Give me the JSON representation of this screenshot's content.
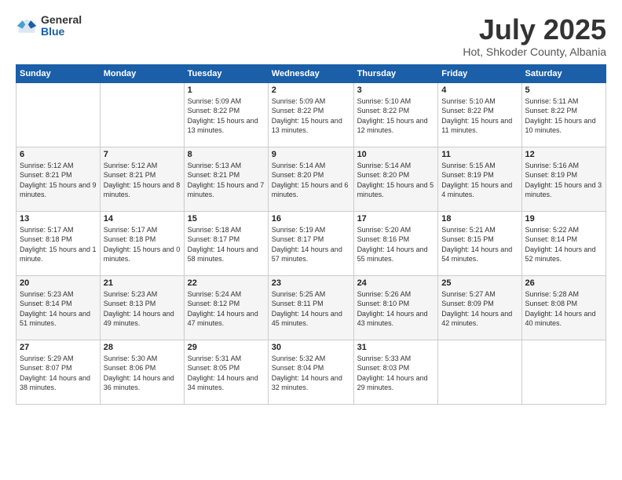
{
  "logo": {
    "general": "General",
    "blue": "Blue"
  },
  "header": {
    "month": "July 2025",
    "location": "Hot, Shkoder County, Albania"
  },
  "weekdays": [
    "Sunday",
    "Monday",
    "Tuesday",
    "Wednesday",
    "Thursday",
    "Friday",
    "Saturday"
  ],
  "weeks": [
    [
      {
        "day": "",
        "sunrise": "",
        "sunset": "",
        "daylight": ""
      },
      {
        "day": "",
        "sunrise": "",
        "sunset": "",
        "daylight": ""
      },
      {
        "day": "1",
        "sunrise": "Sunrise: 5:09 AM",
        "sunset": "Sunset: 8:22 PM",
        "daylight": "Daylight: 15 hours and 13 minutes."
      },
      {
        "day": "2",
        "sunrise": "Sunrise: 5:09 AM",
        "sunset": "Sunset: 8:22 PM",
        "daylight": "Daylight: 15 hours and 13 minutes."
      },
      {
        "day": "3",
        "sunrise": "Sunrise: 5:10 AM",
        "sunset": "Sunset: 8:22 PM",
        "daylight": "Daylight: 15 hours and 12 minutes."
      },
      {
        "day": "4",
        "sunrise": "Sunrise: 5:10 AM",
        "sunset": "Sunset: 8:22 PM",
        "daylight": "Daylight: 15 hours and 11 minutes."
      },
      {
        "day": "5",
        "sunrise": "Sunrise: 5:11 AM",
        "sunset": "Sunset: 8:22 PM",
        "daylight": "Daylight: 15 hours and 10 minutes."
      }
    ],
    [
      {
        "day": "6",
        "sunrise": "Sunrise: 5:12 AM",
        "sunset": "Sunset: 8:21 PM",
        "daylight": "Daylight: 15 hours and 9 minutes."
      },
      {
        "day": "7",
        "sunrise": "Sunrise: 5:12 AM",
        "sunset": "Sunset: 8:21 PM",
        "daylight": "Daylight: 15 hours and 8 minutes."
      },
      {
        "day": "8",
        "sunrise": "Sunrise: 5:13 AM",
        "sunset": "Sunset: 8:21 PM",
        "daylight": "Daylight: 15 hours and 7 minutes."
      },
      {
        "day": "9",
        "sunrise": "Sunrise: 5:14 AM",
        "sunset": "Sunset: 8:20 PM",
        "daylight": "Daylight: 15 hours and 6 minutes."
      },
      {
        "day": "10",
        "sunrise": "Sunrise: 5:14 AM",
        "sunset": "Sunset: 8:20 PM",
        "daylight": "Daylight: 15 hours and 5 minutes."
      },
      {
        "day": "11",
        "sunrise": "Sunrise: 5:15 AM",
        "sunset": "Sunset: 8:19 PM",
        "daylight": "Daylight: 15 hours and 4 minutes."
      },
      {
        "day": "12",
        "sunrise": "Sunrise: 5:16 AM",
        "sunset": "Sunset: 8:19 PM",
        "daylight": "Daylight: 15 hours and 3 minutes."
      }
    ],
    [
      {
        "day": "13",
        "sunrise": "Sunrise: 5:17 AM",
        "sunset": "Sunset: 8:18 PM",
        "daylight": "Daylight: 15 hours and 1 minute."
      },
      {
        "day": "14",
        "sunrise": "Sunrise: 5:17 AM",
        "sunset": "Sunset: 8:18 PM",
        "daylight": "Daylight: 15 hours and 0 minutes."
      },
      {
        "day": "15",
        "sunrise": "Sunrise: 5:18 AM",
        "sunset": "Sunset: 8:17 PM",
        "daylight": "Daylight: 14 hours and 58 minutes."
      },
      {
        "day": "16",
        "sunrise": "Sunrise: 5:19 AM",
        "sunset": "Sunset: 8:17 PM",
        "daylight": "Daylight: 14 hours and 57 minutes."
      },
      {
        "day": "17",
        "sunrise": "Sunrise: 5:20 AM",
        "sunset": "Sunset: 8:16 PM",
        "daylight": "Daylight: 14 hours and 55 minutes."
      },
      {
        "day": "18",
        "sunrise": "Sunrise: 5:21 AM",
        "sunset": "Sunset: 8:15 PM",
        "daylight": "Daylight: 14 hours and 54 minutes."
      },
      {
        "day": "19",
        "sunrise": "Sunrise: 5:22 AM",
        "sunset": "Sunset: 8:14 PM",
        "daylight": "Daylight: 14 hours and 52 minutes."
      }
    ],
    [
      {
        "day": "20",
        "sunrise": "Sunrise: 5:23 AM",
        "sunset": "Sunset: 8:14 PM",
        "daylight": "Daylight: 14 hours and 51 minutes."
      },
      {
        "day": "21",
        "sunrise": "Sunrise: 5:23 AM",
        "sunset": "Sunset: 8:13 PM",
        "daylight": "Daylight: 14 hours and 49 minutes."
      },
      {
        "day": "22",
        "sunrise": "Sunrise: 5:24 AM",
        "sunset": "Sunset: 8:12 PM",
        "daylight": "Daylight: 14 hours and 47 minutes."
      },
      {
        "day": "23",
        "sunrise": "Sunrise: 5:25 AM",
        "sunset": "Sunset: 8:11 PM",
        "daylight": "Daylight: 14 hours and 45 minutes."
      },
      {
        "day": "24",
        "sunrise": "Sunrise: 5:26 AM",
        "sunset": "Sunset: 8:10 PM",
        "daylight": "Daylight: 14 hours and 43 minutes."
      },
      {
        "day": "25",
        "sunrise": "Sunrise: 5:27 AM",
        "sunset": "Sunset: 8:09 PM",
        "daylight": "Daylight: 14 hours and 42 minutes."
      },
      {
        "day": "26",
        "sunrise": "Sunrise: 5:28 AM",
        "sunset": "Sunset: 8:08 PM",
        "daylight": "Daylight: 14 hours and 40 minutes."
      }
    ],
    [
      {
        "day": "27",
        "sunrise": "Sunrise: 5:29 AM",
        "sunset": "Sunset: 8:07 PM",
        "daylight": "Daylight: 14 hours and 38 minutes."
      },
      {
        "day": "28",
        "sunrise": "Sunrise: 5:30 AM",
        "sunset": "Sunset: 8:06 PM",
        "daylight": "Daylight: 14 hours and 36 minutes."
      },
      {
        "day": "29",
        "sunrise": "Sunrise: 5:31 AM",
        "sunset": "Sunset: 8:05 PM",
        "daylight": "Daylight: 14 hours and 34 minutes."
      },
      {
        "day": "30",
        "sunrise": "Sunrise: 5:32 AM",
        "sunset": "Sunset: 8:04 PM",
        "daylight": "Daylight: 14 hours and 32 minutes."
      },
      {
        "day": "31",
        "sunrise": "Sunrise: 5:33 AM",
        "sunset": "Sunset: 8:03 PM",
        "daylight": "Daylight: 14 hours and 29 minutes."
      },
      {
        "day": "",
        "sunrise": "",
        "sunset": "",
        "daylight": ""
      },
      {
        "day": "",
        "sunrise": "",
        "sunset": "",
        "daylight": ""
      }
    ]
  ]
}
